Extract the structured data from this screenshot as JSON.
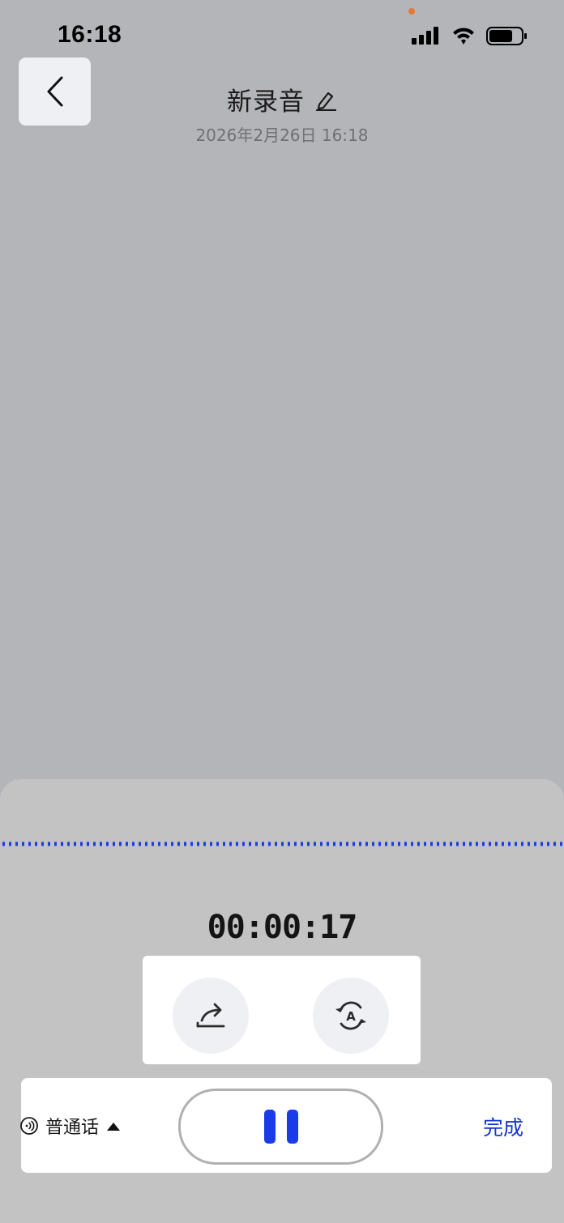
{
  "status_bar": {
    "time": "16:18"
  },
  "header": {
    "title": "新录音",
    "date": "2026年2月26日 16:18"
  },
  "recorder": {
    "elapsed": "00:00:17",
    "language": "普通话",
    "done_label": "完成"
  },
  "colors": {
    "accent": "#1a3be8",
    "done_text": "#1336d8",
    "backdrop": "#b4b5b8",
    "sheet": "#c3c3c3"
  },
  "icons": {
    "back": "chevron-left-icon",
    "edit": "pencil-icon",
    "share": "share-icon",
    "translate": "translate-icon",
    "language": "sound-waves-icon",
    "language_dropdown": "caret-up-icon",
    "pause": "pause-icon"
  }
}
